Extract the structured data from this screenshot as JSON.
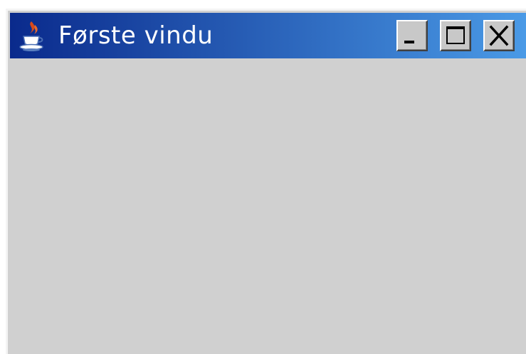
{
  "window": {
    "title": "Første vindu",
    "app_icon": "java-cup-icon",
    "titlebar_colors": {
      "start": "#0a2a8c",
      "end": "#4a9ae6"
    },
    "client_background": "#d0d0d0",
    "controls": {
      "minimize_icon": "minimize-icon",
      "maximize_icon": "maximize-icon",
      "close_icon": "close-icon"
    }
  }
}
